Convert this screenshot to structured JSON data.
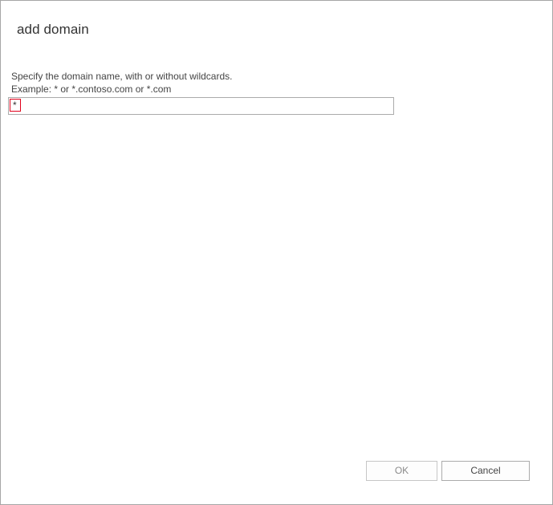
{
  "dialog": {
    "title": "add domain",
    "instruction_line1": "Specify the domain name, with or without wildcards.",
    "instruction_line2": "Example: * or *.contoso.com or *.com",
    "domain_input": {
      "value": "*"
    },
    "buttons": {
      "ok_label": "OK",
      "cancel_label": "Cancel"
    }
  },
  "colors": {
    "highlight_border": "#e0001b",
    "disabled_text": "#8a8a8a"
  }
}
